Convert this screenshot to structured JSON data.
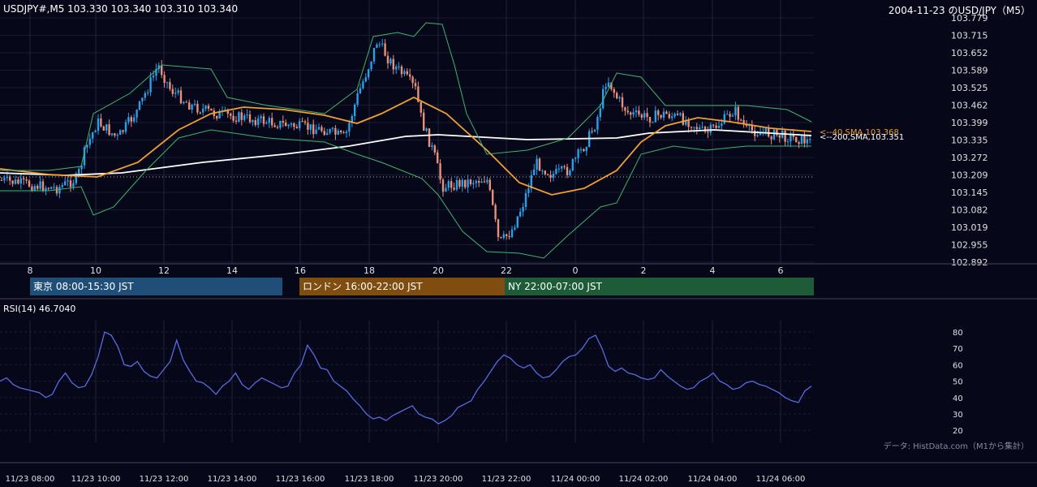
{
  "header": {
    "symbol_quote": "USDJPY#,M5 103.330 103.340 103.310 103.340",
    "chart_title": "2004-11-23 のUSD/JPY（M5）"
  },
  "price_axis": {
    "ticks": [
      "103.779",
      "103.715",
      "103.652",
      "103.589",
      "103.525",
      "103.462",
      "103.399",
      "103.335",
      "103.272",
      "103.209",
      "103.145",
      "103.082",
      "103.019",
      "102.955",
      "102.892"
    ]
  },
  "time_axis_hours": [
    "8",
    "10",
    "12",
    "14",
    "16",
    "18",
    "20",
    "22",
    "0",
    "2",
    "4",
    "6"
  ],
  "overlay_labels": {
    "sma40": "<--40,SMA,103.368",
    "sma200": "<--200,SMA,103.351"
  },
  "sessions": [
    {
      "label": "東京 08:00-15:30 JST",
      "color": "#1f4e79"
    },
    {
      "label": "ロンドン 16:00-22:00 JST",
      "color": "#7f4d0f"
    },
    {
      "label": "NY 22:00-07:00 JST",
      "color": "#1e5c38"
    }
  ],
  "rsi": {
    "label": "RSI(14) 46.7040",
    "ticks": [
      "80",
      "70",
      "60",
      "50",
      "40",
      "30",
      "20"
    ],
    "values": [
      50,
      52,
      48,
      46,
      45,
      44,
      43,
      40,
      42,
      50,
      55,
      49,
      46,
      47,
      54,
      65,
      80,
      78,
      71,
      60,
      59,
      62,
      56,
      53,
      52,
      57,
      62,
      75,
      63,
      56,
      50,
      49,
      46,
      42,
      47,
      50,
      55,
      48,
      45,
      49,
      52,
      50,
      48,
      46,
      47,
      55,
      60,
      72,
      66,
      58,
      57,
      50,
      47,
      44,
      39,
      35,
      30,
      27,
      28,
      26,
      29,
      31,
      33,
      35,
      30,
      28,
      27,
      24,
      26,
      29,
      34,
      36,
      38,
      45,
      50,
      56,
      62,
      66,
      64,
      60,
      58,
      60,
      55,
      52,
      53,
      57,
      62,
      65,
      66,
      70,
      76,
      78,
      70,
      59,
      56,
      58,
      55,
      54,
      52,
      51,
      52,
      57,
      53,
      50,
      47,
      45,
      46,
      50,
      52,
      55,
      50,
      48,
      45,
      46,
      49,
      50,
      48,
      47,
      45,
      43,
      40,
      38,
      37,
      44,
      47
    ],
    "line_color": "#5a6be0"
  },
  "credit": "データ: HistData.com（M1から集計）",
  "date_axis": [
    "11/23 08:00",
    "11/23 10:00",
    "11/23 12:00",
    "11/23 14:00",
    "11/23 16:00",
    "11/23 18:00",
    "11/23 20:00",
    "11/23 22:00",
    "11/24 00:00",
    "11/24 02:00",
    "11/24 04:00",
    "11/24 06:00"
  ],
  "colors": {
    "background": "#07071a",
    "bull": "#2aa0e8",
    "bear": "#e8907a",
    "sma40": "#f0a030",
    "sma200": "#ffffff",
    "bollinger": "#3fb56a"
  }
}
